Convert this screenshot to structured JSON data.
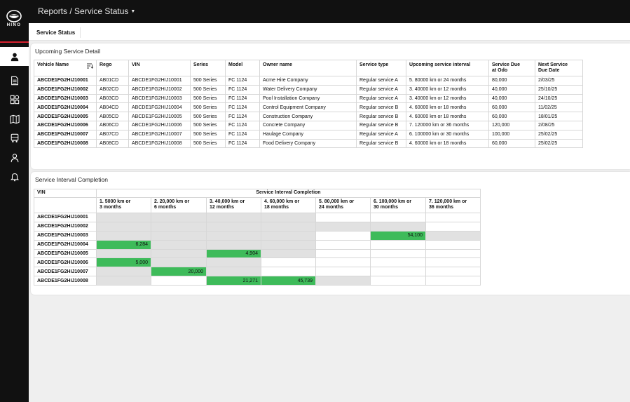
{
  "app": {
    "logo_text": "HINO",
    "breadcrumb": "Reports / Service Status",
    "tab": "Service Status"
  },
  "sidebar": {
    "icons": [
      "user-icon",
      "document-icon",
      "dashboard-icon",
      "map-icon",
      "truck-icon",
      "driver-icon",
      "bell-icon"
    ],
    "active": "user-icon"
  },
  "colors": {
    "accent_red": "#d8212f",
    "bar_green": "#3ebb5a",
    "cell_gray": "#e1e1e1",
    "chrome_black": "#111111"
  },
  "detail": {
    "title": "Upcoming Service Detail",
    "headers": [
      "Vehicle Name",
      "Rego",
      "VIN",
      "Series",
      "Model",
      "Owner name",
      "Service type",
      "Upcoming service interval",
      "Service Due at Odo",
      "Next Service Due Date"
    ],
    "rows": [
      [
        "ABCDE1FG2HIJ10001",
        "AB01CD",
        "ABCDE1FG2HIJ10001",
        "500 Series",
        "FC 1124",
        "Acme Hire Company",
        "Regular service A",
        "5. 80000 km or 24 months",
        "80,000",
        "2/03/25"
      ],
      [
        "ABCDE1FG2HIJ10002",
        "AB02CD",
        "ABCDE1FG2HIJ10002",
        "500 Series",
        "FC 1124",
        "Water Delivery Company",
        "Regular service A",
        "3. 40000 km or 12 months",
        "40,000",
        "25/10/25"
      ],
      [
        "ABCDE1FG2HIJ10003",
        "AB03CD",
        "ABCDE1FG2HIJ10003",
        "500 Series",
        "FC 1124",
        "Pool Installation Company",
        "Regular service A",
        "3. 40000 km or 12 months",
        "40,000",
        "24/10/25"
      ],
      [
        "ABCDE1FG2HIJ10004",
        "AB04CD",
        "ABCDE1FG2HIJ10004",
        "500 Series",
        "FC 1124",
        "Control Equipment Company",
        "Regular service B",
        "4. 60000 km or 18 months",
        "60,000",
        "11/02/25"
      ],
      [
        "ABCDE1FG2HIJ10005",
        "AB05CD",
        "ABCDE1FG2HIJ10005",
        "500 Series",
        "FC 1124",
        "Construction Company",
        "Regular service B",
        "4. 60000 km or 18 months",
        "60,000",
        "18/01/25"
      ],
      [
        "ABCDE1FG2HIJ10006",
        "AB06CD",
        "ABCDE1FG2HIJ10006",
        "500 Series",
        "FC 1124",
        "Concrete Company",
        "Regular service B",
        "7. 120000 km or 36 months",
        "120,000",
        "2/08/25"
      ],
      [
        "ABCDE1FG2HIJ10007",
        "AB07CD",
        "ABCDE1FG2HIJ10007",
        "500 Series",
        "FC 1124",
        "Haulage Company",
        "Regular service A",
        "6. 100000 km or 30 months",
        "100,000",
        "25/02/25"
      ],
      [
        "ABCDE1FG2HIJ10008",
        "AB08CD",
        "ABCDE1FG2HIJ10008",
        "500 Series",
        "FC 1124",
        "Food Delivery Company",
        "Regular service B",
        "4. 60000 km or 18 months",
        "60,000",
        "25/02/25"
      ]
    ]
  },
  "interval": {
    "title": "Service Interval Completion",
    "vin_header": "VIN",
    "super_header": "Service Interval Completion",
    "columns": [
      [
        "1. 5000 km or",
        "3 months"
      ],
      [
        "2. 20,000 km or",
        "6 months"
      ],
      [
        "3. 40,000 km or",
        "12 months"
      ],
      [
        "4. 60,000 km or",
        "18 months"
      ],
      [
        "5. 80,000 km or",
        "24 months"
      ],
      [
        "6. 100,000 km or",
        "30 months"
      ],
      [
        "7. 120,000 km or",
        "36 months"
      ]
    ],
    "rows": [
      {
        "vin": "ABCDE1FG2HIJ10001",
        "cells": [
          [
            "g",
            ""
          ],
          [
            "g",
            ""
          ],
          [
            "g",
            ""
          ],
          [
            "g",
            ""
          ],
          [
            "w",
            ""
          ],
          [
            "w",
            ""
          ],
          [
            "w",
            ""
          ]
        ]
      },
      {
        "vin": "ABCDE1FG2HIJ10002",
        "cells": [
          [
            "g",
            ""
          ],
          [
            "g",
            ""
          ],
          [
            "g",
            ""
          ],
          [
            "g",
            ""
          ],
          [
            "g",
            ""
          ],
          [
            "g",
            ""
          ],
          [
            "w",
            ""
          ]
        ]
      },
      {
        "vin": "ABCDE1FG2HIJ10003",
        "cells": [
          [
            "g",
            ""
          ],
          [
            "g",
            ""
          ],
          [
            "g",
            ""
          ],
          [
            "g",
            ""
          ],
          [
            "w",
            ""
          ],
          [
            "gr",
            "54,100"
          ],
          [
            "g",
            ""
          ]
        ]
      },
      {
        "vin": "ABCDE1FG2HIJ10004",
        "cells": [
          [
            "gr",
            "6,284"
          ],
          [
            "g",
            ""
          ],
          [
            "g",
            ""
          ],
          [
            "g",
            ""
          ],
          [
            "w",
            ""
          ],
          [
            "w",
            ""
          ],
          [
            "w",
            ""
          ]
        ]
      },
      {
        "vin": "ABCDE1FG2HIJ10005",
        "cells": [
          [
            "g",
            ""
          ],
          [
            "g",
            ""
          ],
          [
            "gr",
            "4,904"
          ],
          [
            "g",
            ""
          ],
          [
            "w",
            ""
          ],
          [
            "w",
            ""
          ],
          [
            "w",
            ""
          ]
        ]
      },
      {
        "vin": "ABCDE1FG2HIJ10006",
        "cells": [
          [
            "gr",
            "5,000"
          ],
          [
            "g",
            ""
          ],
          [
            "g",
            ""
          ],
          [
            "w",
            ""
          ],
          [
            "w",
            ""
          ],
          [
            "w",
            ""
          ],
          [
            "w",
            ""
          ]
        ]
      },
      {
        "vin": "ABCDE1FG2HIJ10007",
        "cells": [
          [
            "g",
            ""
          ],
          [
            "gr",
            "20,000"
          ],
          [
            "g",
            ""
          ],
          [
            "w",
            ""
          ],
          [
            "w",
            ""
          ],
          [
            "w",
            ""
          ],
          [
            "w",
            ""
          ]
        ]
      },
      {
        "vin": "ABCDE1FG2HIJ10008",
        "cells": [
          [
            "g",
            ""
          ],
          [
            "w",
            ""
          ],
          [
            "gr",
            "21,271"
          ],
          [
            "gr",
            "45,739"
          ],
          [
            "g",
            ""
          ],
          [
            "w",
            ""
          ],
          [
            "w",
            ""
          ]
        ]
      }
    ]
  }
}
